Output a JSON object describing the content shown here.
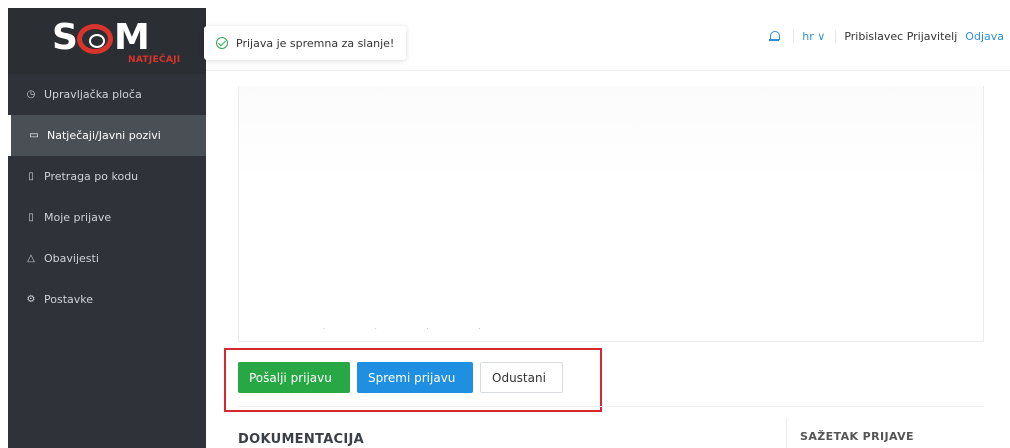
{
  "brand": {
    "logo_text": "SOM",
    "logo_sub": "NATJEČAJI"
  },
  "sidebar": {
    "items": [
      {
        "label": "Upravljačka ploča",
        "icon": "dashboard-icon",
        "glyph": "◷"
      },
      {
        "label": "Natječaji/Javni pozivi",
        "icon": "folder-open-icon",
        "glyph": "▭",
        "active": true
      },
      {
        "label": "Pretraga po kodu",
        "icon": "document-icon",
        "glyph": "▯"
      },
      {
        "label": "Moje prijave",
        "icon": "file-icon",
        "glyph": "▯"
      },
      {
        "label": "Obavijesti",
        "icon": "bell-icon",
        "glyph": "△"
      },
      {
        "label": "Postavke",
        "icon": "settings-icon",
        "glyph": "⚙"
      }
    ]
  },
  "toast": {
    "message": "Prijava je spremna za slanje!",
    "status_color": "#2fa84f"
  },
  "header": {
    "language": "hr ∨",
    "user_name": "Pribislavec Prijavitelj",
    "logout_label": "Odjava"
  },
  "actions": {
    "send_label": "Pošalji prijavu",
    "save_label": "Spremi prijavu",
    "cancel_label": "Odustani"
  },
  "sections": {
    "documents_title": "DOKUMENTACIJA",
    "summary_title": "SAŽETAK PRIJAVE"
  },
  "colors": {
    "primary": "#1e8fe1",
    "success": "#28a745",
    "sidebar": "#2f3238",
    "highlight": "#d9272e"
  }
}
